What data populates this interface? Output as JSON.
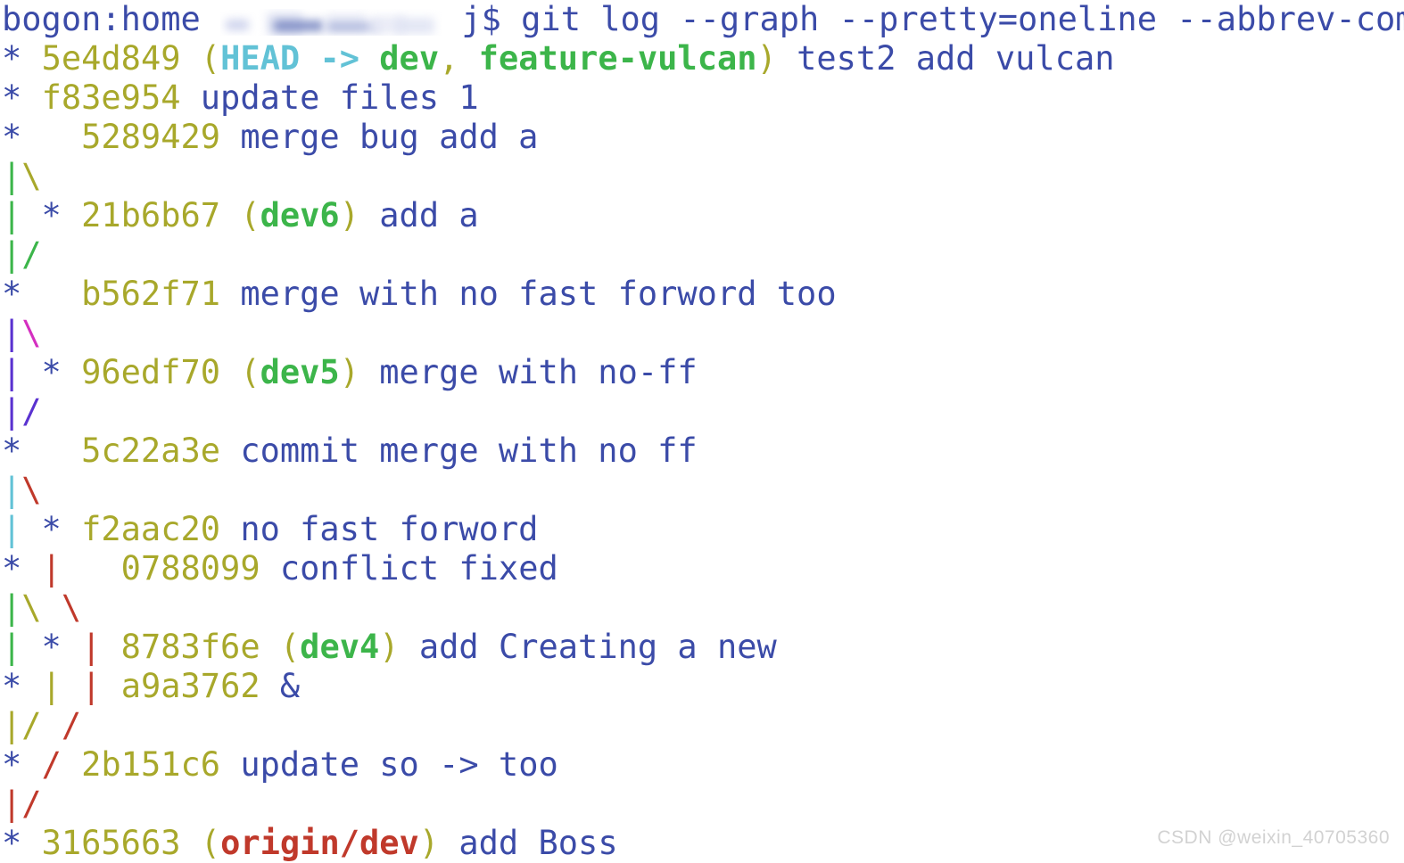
{
  "terminal": {
    "background_color": "#ffffff",
    "prompt": {
      "host_user": "bogon:home",
      "redacted_username": "",
      "prompt_symbol": "j$",
      "command": "git log --graph --pretty=oneline --abbrev-commit"
    },
    "colors": {
      "text": "#3b4ba8",
      "hash": "#a8a82b",
      "paren": "#a8a82b",
      "head": "#62c2d6",
      "local_branch": "#3cb54a",
      "remote_branch": "#c0392b",
      "graph_blue": "#3b4ba8",
      "graph_green": "#3cb54a",
      "graph_olive": "#a8a82b",
      "graph_violet": "#5a32d0",
      "graph_magenta": "#d42fc0",
      "graph_cyan": "#62c2d6",
      "graph_red": "#c0392b"
    },
    "lines": [
      {
        "type": "prompt",
        "segments": [
          {
            "text": "bogon:home ",
            "style": "c-text"
          },
          {
            "text": "REDACTED",
            "style": "redacted"
          },
          {
            "text": " j$ git log --graph --pretty=oneline --abbrev-commit",
            "style": "c-text"
          }
        ]
      },
      {
        "type": "commit",
        "segments": [
          {
            "text": "* ",
            "style": "c-star"
          },
          {
            "text": "5e4d849",
            "style": "c-hash"
          },
          {
            "text": " (",
            "style": "c-paren"
          },
          {
            "text": "HEAD -> ",
            "style": "c-head"
          },
          {
            "text": "dev",
            "style": "c-branch"
          },
          {
            "text": ", ",
            "style": "c-paren"
          },
          {
            "text": "feature-vulcan",
            "style": "c-branch"
          },
          {
            "text": ")",
            "style": "c-paren"
          },
          {
            "text": " test2 add vulcan",
            "style": "c-text"
          }
        ]
      },
      {
        "type": "commit",
        "segments": [
          {
            "text": "* ",
            "style": "c-star"
          },
          {
            "text": "f83e954",
            "style": "c-hash"
          },
          {
            "text": " update files 1",
            "style": "c-text"
          }
        ]
      },
      {
        "type": "commit",
        "segments": [
          {
            "text": "*   ",
            "style": "c-star"
          },
          {
            "text": "5289429",
            "style": "c-hash"
          },
          {
            "text": " merge bug add a",
            "style": "c-text"
          }
        ]
      },
      {
        "type": "graph",
        "segments": [
          {
            "text": "|",
            "style": "g-green"
          },
          {
            "text": "\\",
            "style": "g-olive"
          }
        ]
      },
      {
        "type": "commit",
        "segments": [
          {
            "text": "|",
            "style": "g-green"
          },
          {
            "text": " * ",
            "style": "c-star"
          },
          {
            "text": "21b6b67",
            "style": "c-hash"
          },
          {
            "text": " (",
            "style": "c-paren"
          },
          {
            "text": "dev6",
            "style": "c-branch"
          },
          {
            "text": ")",
            "style": "c-paren"
          },
          {
            "text": " add a",
            "style": "c-text"
          }
        ]
      },
      {
        "type": "graph",
        "segments": [
          {
            "text": "|",
            "style": "g-green"
          },
          {
            "text": "/",
            "style": "g-green"
          }
        ]
      },
      {
        "type": "commit",
        "segments": [
          {
            "text": "*   ",
            "style": "c-star"
          },
          {
            "text": "b562f71",
            "style": "c-hash"
          },
          {
            "text": " merge with no fast forword too",
            "style": "c-text"
          }
        ]
      },
      {
        "type": "graph",
        "segments": [
          {
            "text": "|",
            "style": "g-violet"
          },
          {
            "text": "\\",
            "style": "g-magenta"
          }
        ]
      },
      {
        "type": "commit",
        "segments": [
          {
            "text": "|",
            "style": "g-violet"
          },
          {
            "text": " * ",
            "style": "c-star"
          },
          {
            "text": "96edf70",
            "style": "c-hash"
          },
          {
            "text": " (",
            "style": "c-paren"
          },
          {
            "text": "dev5",
            "style": "c-branch"
          },
          {
            "text": ")",
            "style": "c-paren"
          },
          {
            "text": " merge with no-ff",
            "style": "c-text"
          }
        ]
      },
      {
        "type": "graph",
        "segments": [
          {
            "text": "|",
            "style": "g-violet"
          },
          {
            "text": "/",
            "style": "g-violet"
          }
        ]
      },
      {
        "type": "commit",
        "segments": [
          {
            "text": "*   ",
            "style": "c-star"
          },
          {
            "text": "5c22a3e",
            "style": "c-hash"
          },
          {
            "text": " commit merge with no ff",
            "style": "c-text"
          }
        ]
      },
      {
        "type": "graph",
        "segments": [
          {
            "text": "|",
            "style": "g-cyan"
          },
          {
            "text": "\\",
            "style": "g-red"
          }
        ]
      },
      {
        "type": "commit",
        "segments": [
          {
            "text": "|",
            "style": "g-cyan"
          },
          {
            "text": " * ",
            "style": "c-star"
          },
          {
            "text": "f2aac20",
            "style": "c-hash"
          },
          {
            "text": " no fast forword",
            "style": "c-text"
          }
        ]
      },
      {
        "type": "commit",
        "segments": [
          {
            "text": "* ",
            "style": "c-star"
          },
          {
            "text": "|",
            "style": "g-red"
          },
          {
            "text": "   ",
            "style": "c-text"
          },
          {
            "text": "0788099",
            "style": "c-hash"
          },
          {
            "text": " conflict fixed",
            "style": "c-text"
          }
        ]
      },
      {
        "type": "graph",
        "segments": [
          {
            "text": "|",
            "style": "g-green"
          },
          {
            "text": "\\",
            "style": "g-olive"
          },
          {
            "text": " ",
            "style": "c-text"
          },
          {
            "text": "\\",
            "style": "g-red"
          }
        ]
      },
      {
        "type": "commit",
        "segments": [
          {
            "text": "|",
            "style": "g-green"
          },
          {
            "text": " * ",
            "style": "c-star"
          },
          {
            "text": "|",
            "style": "g-red"
          },
          {
            "text": " ",
            "style": "c-text"
          },
          {
            "text": "8783f6e",
            "style": "c-hash"
          },
          {
            "text": " (",
            "style": "c-paren"
          },
          {
            "text": "dev4",
            "style": "c-branch"
          },
          {
            "text": ")",
            "style": "c-paren"
          },
          {
            "text": " add Creating a new",
            "style": "c-text"
          }
        ]
      },
      {
        "type": "commit",
        "segments": [
          {
            "text": "* ",
            "style": "c-star"
          },
          {
            "text": "|",
            "style": "g-olive"
          },
          {
            "text": " ",
            "style": "c-text"
          },
          {
            "text": "|",
            "style": "g-red"
          },
          {
            "text": " ",
            "style": "c-text"
          },
          {
            "text": "a9a3762",
            "style": "c-hash"
          },
          {
            "text": " &",
            "style": "c-text"
          }
        ]
      },
      {
        "type": "graph",
        "segments": [
          {
            "text": "|",
            "style": "g-olive"
          },
          {
            "text": "/",
            "style": "g-olive"
          },
          {
            "text": " ",
            "style": "c-text"
          },
          {
            "text": "/",
            "style": "g-red"
          }
        ]
      },
      {
        "type": "commit",
        "segments": [
          {
            "text": "* ",
            "style": "c-star"
          },
          {
            "text": "/",
            "style": "g-red"
          },
          {
            "text": " ",
            "style": "c-text"
          },
          {
            "text": "2b151c6",
            "style": "c-hash"
          },
          {
            "text": " update so -> too",
            "style": "c-text"
          }
        ]
      },
      {
        "type": "graph",
        "segments": [
          {
            "text": "|",
            "style": "g-red"
          },
          {
            "text": "/",
            "style": "g-red"
          }
        ]
      },
      {
        "type": "commit",
        "segments": [
          {
            "text": "* ",
            "style": "c-star"
          },
          {
            "text": "3165663",
            "style": "c-hash"
          },
          {
            "text": " (",
            "style": "c-paren"
          },
          {
            "text": "origin/dev",
            "style": "c-remote"
          },
          {
            "text": ")",
            "style": "c-paren"
          },
          {
            "text": " add Boss",
            "style": "c-text"
          }
        ]
      }
    ]
  },
  "watermark": {
    "text": "CSDN @weixin_40705360"
  }
}
